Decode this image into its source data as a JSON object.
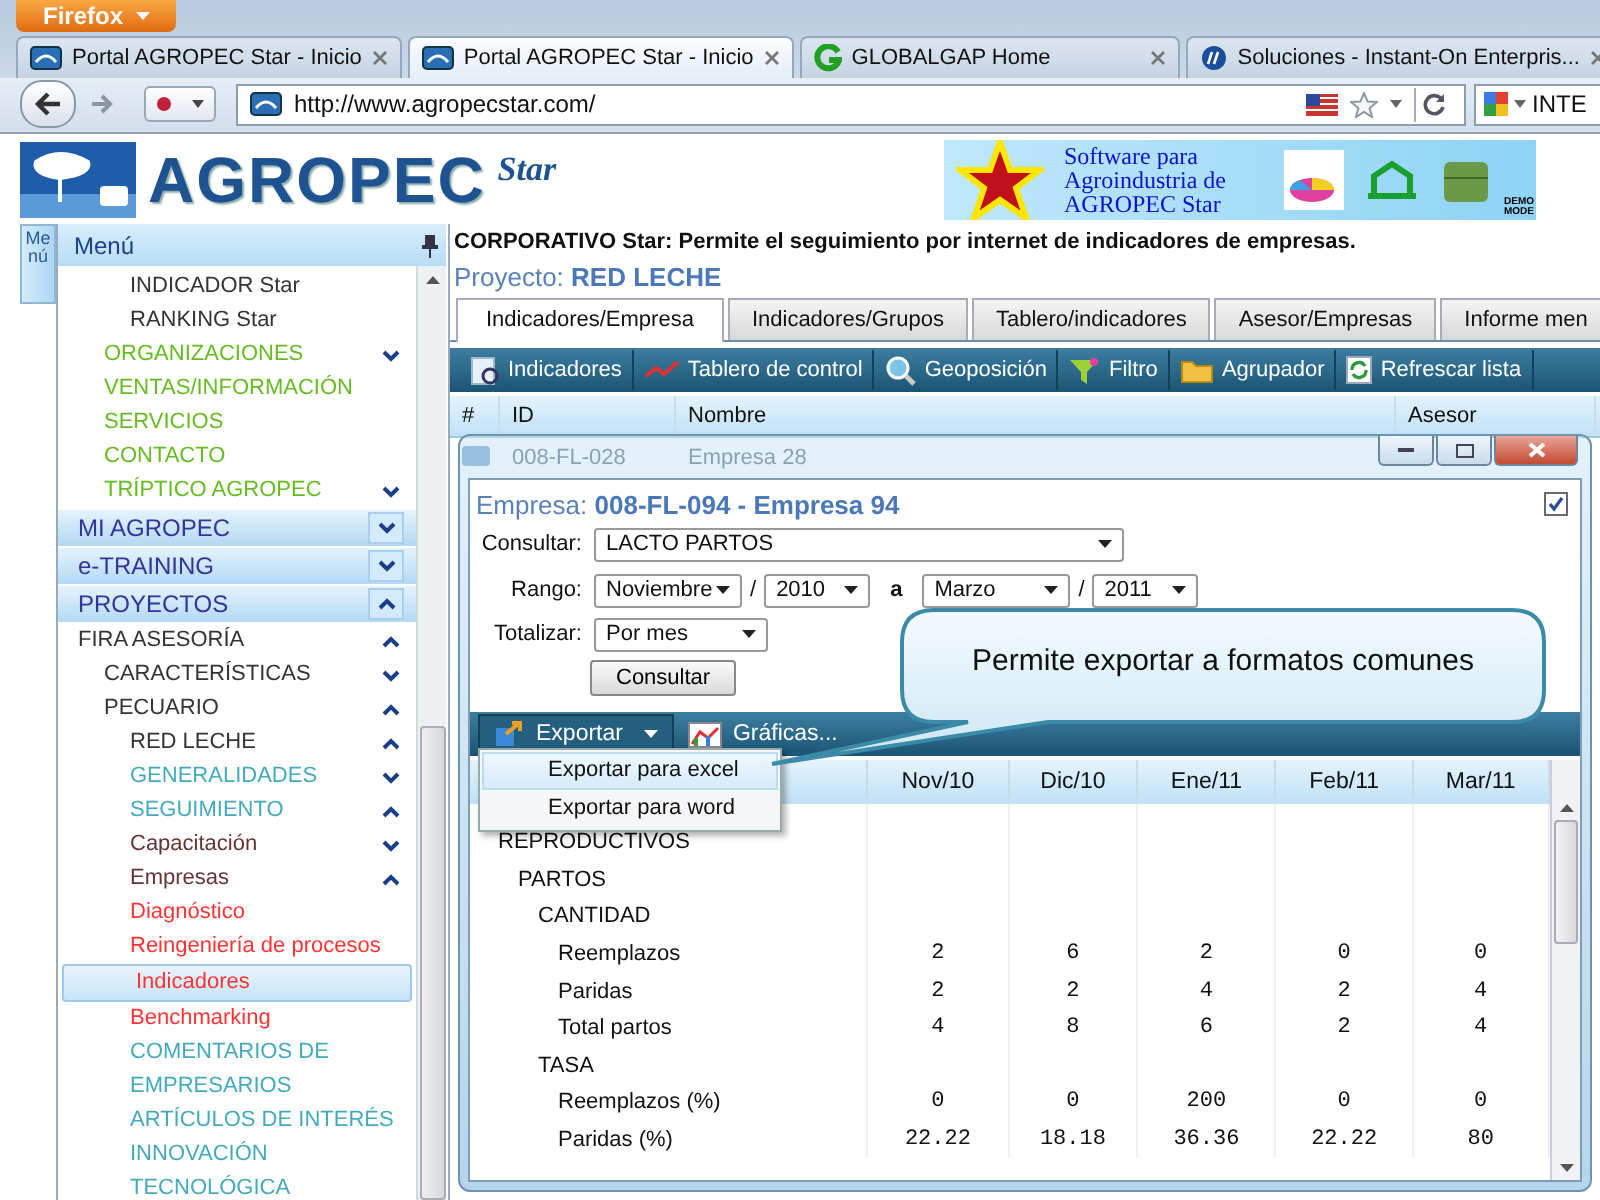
{
  "browser": {
    "menu_button": "Firefox",
    "tabs": [
      {
        "title": "Portal AGROPEC Star - Inicio",
        "kind": "site",
        "selected": false
      },
      {
        "title": "Portal AGROPEC Star - Inicio",
        "kind": "site",
        "selected": true
      },
      {
        "title": "GLOBALGAP Home",
        "kind": "ring",
        "selected": false
      },
      {
        "title": "Soluciones - Instant-On Enterpris...",
        "kind": "globe",
        "selected": false
      }
    ],
    "url": "http://www.agropecstar.com/",
    "search": "INTE"
  },
  "header": {
    "logo": "AGROPEC",
    "logo_script": "Star",
    "banner": [
      "Software para",
      "Agroindustria de",
      "AGROPEC Star"
    ],
    "badge": "DEMO MODE"
  },
  "side_tab": "Menú",
  "menu": {
    "title": "Menú",
    "sections": [
      {
        "items": [
          {
            "children": [
              {
                "children": [
                  {
                    "label": "INDICADOR Star",
                    "color": "#333333",
                    "selected": false
                  },
                  {
                    "label": "RANKING Star",
                    "color": "#333333",
                    "selected": false
                  }
                ]
              },
              {
                "label": "ORGANIZACIONES",
                "color": "#66bb22",
                "selected": false,
                "expanded": false
              },
              {
                "label": "VENTAS/INFORMACIÓN",
                "color": "#66bb22",
                "selected": false
              },
              {
                "label": "SERVICIOS",
                "color": "#66bb22",
                "selected": false
              },
              {
                "label": "CONTACTO",
                "color": "#66bb22",
                "selected": false
              },
              {
                "label": "TRÍPTICO AGROPEC",
                "color": "#66bb22",
                "selected": false,
                "expanded": false
              }
            ]
          }
        ]
      },
      {
        "label": "MI AGROPEC",
        "expanded": false
      },
      {
        "label": "e-TRAINING",
        "expanded": false
      },
      {
        "label": "PROYECTOS",
        "expanded": true,
        "items": [
          {
            "label": "FIRA ASESORÍA",
            "color": "#333333",
            "selected": false,
            "expanded": true,
            "children": [
              {
                "label": "CARACTERÍSTICAS",
                "color": "#333333",
                "selected": false,
                "expanded": false
              },
              {
                "label": "PECUARIO",
                "color": "#333333",
                "selected": false,
                "expanded": true,
                "children": [
                  {
                    "label": "RED LECHE",
                    "color": "#333333",
                    "selected": false,
                    "expanded": true
                  },
                  {
                    "label": "GENERALIDADES",
                    "color": "#44aabb",
                    "selected": false,
                    "expanded": false
                  },
                  {
                    "label": "SEGUIMIENTO",
                    "color": "#44aabb",
                    "selected": false,
                    "expanded": true
                  },
                  {
                    "label": "Capacitación",
                    "color": "#663333",
                    "selected": false,
                    "expanded": false
                  },
                  {
                    "label": "Empresas",
                    "color": "#663333",
                    "selected": false,
                    "expanded": true
                  },
                  {
                    "label": "Diagnóstico",
                    "color": "#ff3333",
                    "selected": false
                  },
                  {
                    "label": "Reingeniería de procesos",
                    "color": "#ff3333",
                    "selected": false
                  },
                  {
                    "label": "Indicadores",
                    "color": "#ff3333",
                    "selected": true
                  },
                  {
                    "label": "Benchmarking",
                    "color": "#ff3333",
                    "selected": false
                  },
                  {
                    "label": "COMENTARIOS DE EMPRESARIOS",
                    "color": "#44aabb",
                    "selected": false
                  },
                  {
                    "label": "ARTÍCULOS DE INTERÉS",
                    "color": "#44aabb",
                    "selected": false
                  },
                  {
                    "label": "INNOVACIÓN TECNOLÓGICA",
                    "color": "#44aabb",
                    "selected": false
                  }
                ]
              }
            ]
          }
        ]
      }
    ]
  },
  "description": "CORPORATIVO Star: Permite el seguimiento por internet de indicadores de empresas.",
  "project": {
    "label": "Proyecto:",
    "value": "RED LECHE"
  },
  "tabs": [
    {
      "label": "Indicadores/Empresa",
      "selected": true
    },
    {
      "label": "Indicadores/Grupos",
      "selected": false
    },
    {
      "label": "Tablero/indicadores",
      "selected": false
    },
    {
      "label": "Asesor/Empresas",
      "selected": false
    },
    {
      "label": "Informe men",
      "selected": false
    }
  ],
  "toolbar": [
    {
      "label": "Indicadores",
      "kind": "report"
    },
    {
      "label": "Tablero de control",
      "kind": "trend"
    },
    {
      "label": "Geoposición",
      "kind": "magnifier"
    },
    {
      "label": "Filtro",
      "kind": "funnel"
    },
    {
      "label": "Agrupador",
      "kind": "folder"
    },
    {
      "label": "Refrescar lista",
      "kind": "refresh"
    }
  ],
  "grid": {
    "columns": [
      "#",
      "ID",
      "Nombre",
      "Asesor"
    ],
    "rows": [
      {
        "cells": [
          "",
          "008-FL-028",
          "Empresa 28"
        ]
      }
    ]
  },
  "dialog": {
    "title_label": "Empresa:",
    "title_value": "008-FL-094 - Empresa 94",
    "pinned": true,
    "consultar": {
      "label": "Consultar:",
      "value": "LACTO PARTOS"
    },
    "rango": {
      "label": "Rango:",
      "from_month": "Noviembre",
      "from_sep": "/",
      "from_year": "2010",
      "joiner": "a",
      "to_month": "Marzo",
      "to_sep": "/",
      "to_year": "2011"
    },
    "totalizar": {
      "label": "Totalizar:",
      "value": "Por mes"
    },
    "button": "Consultar",
    "export_toolbar": [
      {
        "label": "Exportar",
        "kind": "export"
      },
      {
        "label": "Gráficas...",
        "kind": "chart"
      }
    ],
    "export_menu": [
      {
        "label": "Exportar para excel",
        "selected": true
      },
      {
        "label": "Exportar para word",
        "selected": false
      }
    ],
    "table": {
      "columns": [
        "Nov/10",
        "Dic/10",
        "Ene/11",
        "Feb/11",
        "Mar/11"
      ],
      "rows": [
        {
          "label": "REPRODUCTIVOS",
          "children": [
            {
              "label": "PARTOS",
              "children": [
                {
                  "label": "CANTIDAD",
                  "children": [
                    {
                      "label": "Reemplazos",
                      "values": [
                        "2",
                        "6",
                        "2",
                        "0",
                        "0"
                      ]
                    },
                    {
                      "label": "Paridas",
                      "values": [
                        "2",
                        "2",
                        "4",
                        "2",
                        "4"
                      ]
                    },
                    {
                      "label": "Total partos",
                      "values": [
                        "4",
                        "8",
                        "6",
                        "2",
                        "4"
                      ]
                    }
                  ]
                },
                {
                  "label": "TASA",
                  "children": [
                    {
                      "label": "Reemplazos (%)",
                      "values": [
                        "0",
                        "0",
                        "200",
                        "0",
                        "0"
                      ]
                    },
                    {
                      "label": "Paridas (%)",
                      "values": [
                        "22.22",
                        "18.18",
                        "36.36",
                        "22.22",
                        "80"
                      ]
                    }
                  ]
                }
              ]
            }
          ]
        }
      ]
    }
  },
  "callout": "Permite exportar a formatos comunes"
}
